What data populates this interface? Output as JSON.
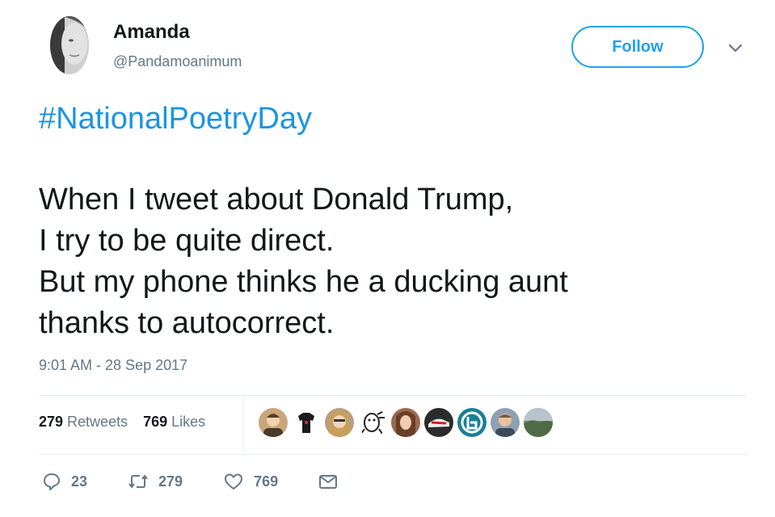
{
  "author": {
    "display_name": "Amanda",
    "handle": "@Pandamoanimum"
  },
  "follow_button": {
    "label": "Follow"
  },
  "tweet": {
    "hashtag": "#NationalPoetryDay",
    "lines": [
      "When I tweet about Donald Trump,",
      "I try to be quite direct.",
      "But my phone thinks he a ducking aunt",
      "thanks to autocorrect."
    ],
    "timestamp": "9:01 AM - 28 Sep 2017"
  },
  "stats": {
    "retweets_count": "279",
    "retweets_label": "Retweets",
    "likes_count": "769",
    "likes_label": "Likes"
  },
  "likers": [
    {
      "icon": "person-avatar",
      "color": "#c9a77a"
    },
    {
      "icon": "tshirt-avatar",
      "color": "#ffffff"
    },
    {
      "icon": "person-avatar",
      "color": "#b89c8a"
    },
    {
      "icon": "cartoon-avatar",
      "color": "#ffffff"
    },
    {
      "icon": "person-avatar",
      "color": "#9a6a50"
    },
    {
      "icon": "shoe-avatar",
      "color": "#2b2b2b"
    },
    {
      "icon": "logo-avatar",
      "color": "#1a7f96"
    },
    {
      "icon": "person-avatar",
      "color": "#8fa0b0"
    },
    {
      "icon": "landscape-avatar",
      "color": "#6f8a6a"
    }
  ],
  "actions": {
    "reply_count": "23",
    "retweet_count": "279",
    "like_count": "769"
  },
  "colors": {
    "accent": "#1da1f2",
    "hashtag": "#1b95e0",
    "secondary_text": "#657786",
    "divider": "#e6ecf0"
  }
}
